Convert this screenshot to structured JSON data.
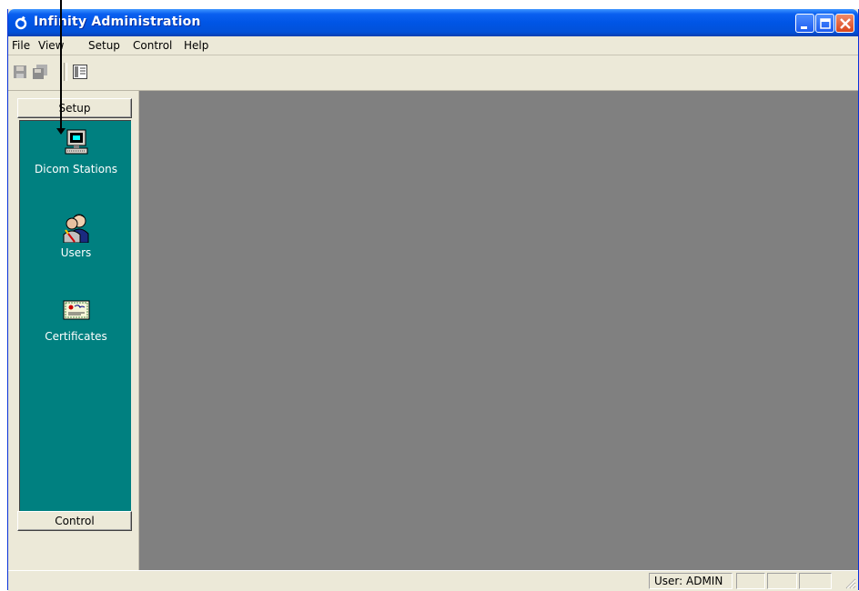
{
  "window": {
    "title": "Infinity Administration",
    "title_bar_color": "#0055e5"
  },
  "menu": {
    "items": [
      "File",
      "View",
      "Setup",
      "Control",
      "Help"
    ]
  },
  "toolbar": {
    "buttons": [
      "save-icon",
      "save-all-icon",
      "properties-icon"
    ]
  },
  "left_pane": {
    "setup_header": "Setup",
    "control_header": "Control",
    "panel_color": "#008080",
    "items": [
      {
        "label": "Dicom Stations",
        "icon": "computer-icon"
      },
      {
        "label": "Users",
        "icon": "users-icon"
      },
      {
        "label": "Certificates",
        "icon": "certificate-icon"
      }
    ]
  },
  "mdi_area": {
    "background": "#808080"
  },
  "status_bar": {
    "user": "User: ADMIN"
  }
}
